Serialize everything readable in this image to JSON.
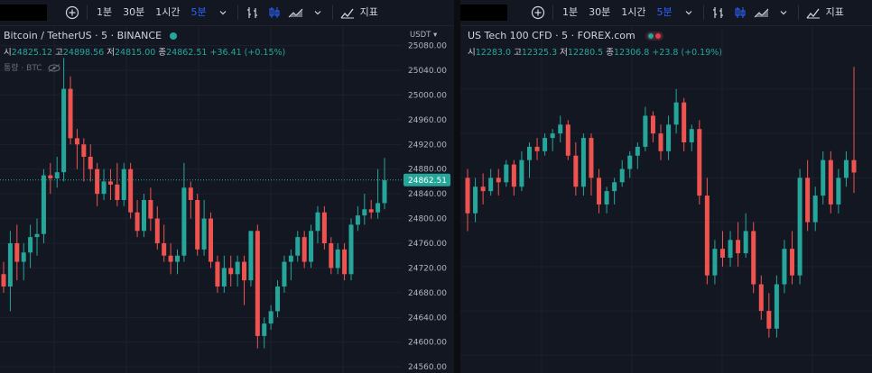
{
  "toolbar": {
    "intervals": [
      "1분",
      "30분",
      "1시간",
      "5분"
    ],
    "indicators_label": "지표"
  },
  "left": {
    "symbol_title": "Bitcoin / TetherUS · 5 · BINANCE",
    "status_color": "#26a69a",
    "ohlc": {
      "o_label": "시",
      "o": "24825.12",
      "h_label": "고",
      "h": "24898.56",
      "l_label": "저",
      "l": "24815.00",
      "c_label": "종",
      "c": "24862.51",
      "change": "+36.41 (+0.15%)"
    },
    "volume_label": "통량 · BTC",
    "currency_label": "USDT",
    "last_price": "24862.51"
  },
  "right": {
    "symbol_title": "US Tech 100 CFD · 5 · FOREX.com",
    "status_color": "#26a69a",
    "ohlc": {
      "o_label": "시",
      "o": "12283.0",
      "h_label": "고",
      "h": "12325.3",
      "l_label": "저",
      "l": "12280.5",
      "c_label": "종",
      "c": "12306.8",
      "change": "+23.8 (+0.19%)"
    }
  },
  "chart_data": [
    {
      "type": "candlestick",
      "title": "Bitcoin / TetherUS · 5 · BINANCE",
      "ylim": [
        24550,
        25110
      ],
      "yticks": [
        25080,
        25040,
        25000,
        24960,
        24920,
        24880,
        24840,
        24800,
        24760,
        24720,
        24680,
        24640,
        24600,
        24560
      ],
      "last_price": 24862.51,
      "candles": [
        [
          24710,
          24730,
          24680,
          24690
        ],
        [
          24690,
          24780,
          24650,
          24760
        ],
        [
          24760,
          24790,
          24700,
          24730
        ],
        [
          24730,
          24760,
          24700,
          24745
        ],
        [
          24745,
          24790,
          24720,
          24770
        ],
        [
          24770,
          24800,
          24740,
          24775
        ],
        [
          24775,
          24880,
          24760,
          24870
        ],
        [
          24870,
          24890,
          24840,
          24865
        ],
        [
          24865,
          24900,
          24850,
          24875
        ],
        [
          24875,
          25060,
          24860,
          25010
        ],
        [
          25010,
          25030,
          24920,
          24930
        ],
        [
          24930,
          24945,
          24880,
          24920
        ],
        [
          24920,
          24930,
          24860,
          24900
        ],
        [
          24900,
          24920,
          24860,
          24880
        ],
        [
          24880,
          24890,
          24820,
          24840
        ],
        [
          24840,
          24880,
          24830,
          24860
        ],
        [
          24860,
          24880,
          24830,
          24855
        ],
        [
          24855,
          24890,
          24820,
          24830
        ],
        [
          24830,
          24890,
          24820,
          24880
        ],
        [
          24880,
          24890,
          24800,
          24810
        ],
        [
          24810,
          24830,
          24770,
          24780
        ],
        [
          24780,
          24840,
          24770,
          24830
        ],
        [
          24830,
          24850,
          24780,
          24800
        ],
        [
          24800,
          24820,
          24750,
          24760
        ],
        [
          24760,
          24790,
          24730,
          24740
        ],
        [
          24740,
          24760,
          24710,
          24730
        ],
        [
          24730,
          24750,
          24710,
          24740
        ],
        [
          24740,
          24890,
          24730,
          24850
        ],
        [
          24850,
          24860,
          24800,
          24830
        ],
        [
          24830,
          24840,
          24740,
          24750
        ],
        [
          24750,
          24830,
          24740,
          24800
        ],
        [
          24800,
          24810,
          24720,
          24730
        ],
        [
          24730,
          24740,
          24680,
          24690
        ],
        [
          24690,
          24740,
          24680,
          24720
        ],
        [
          24720,
          24740,
          24690,
          24710
        ],
        [
          24710,
          24740,
          24690,
          24730
        ],
        [
          24730,
          24740,
          24660,
          24700
        ],
        [
          24700,
          24760,
          24690,
          24780
        ],
        [
          24780,
          24790,
          24590,
          24610
        ],
        [
          24610,
          24640,
          24590,
          24630
        ],
        [
          24630,
          24660,
          24620,
          24650
        ],
        [
          24650,
          24700,
          24640,
          24690
        ],
        [
          24690,
          24740,
          24680,
          24730
        ],
        [
          24730,
          24750,
          24700,
          24740
        ],
        [
          24740,
          24780,
          24730,
          24770
        ],
        [
          24770,
          24780,
          24720,
          24730
        ],
        [
          24730,
          24790,
          24720,
          24780
        ],
        [
          24780,
          24820,
          24760,
          24810
        ],
        [
          24810,
          24820,
          24750,
          24760
        ],
        [
          24760,
          24770,
          24710,
          24720
        ],
        [
          24720,
          24760,
          24710,
          24750
        ],
        [
          24750,
          24760,
          24700,
          24710
        ],
        [
          24710,
          24800,
          24700,
          24790
        ],
        [
          24790,
          24820,
          24780,
          24805
        ],
        [
          24805,
          24840,
          24790,
          24815
        ],
        [
          24815,
          24830,
          24800,
          24810
        ],
        [
          24810,
          24880,
          24800,
          24825
        ],
        [
          24825,
          24898,
          24815,
          24862
        ]
      ]
    },
    {
      "type": "candlestick",
      "title": "US Tech 100 CFD · 5 · FOREX.com",
      "candles": [
        [
          12300,
          12310,
          12240,
          12260
        ],
        [
          12260,
          12300,
          12250,
          12290
        ],
        [
          12290,
          12305,
          12270,
          12285
        ],
        [
          12285,
          12310,
          12280,
          12300
        ],
        [
          12300,
          12310,
          12280,
          12295
        ],
        [
          12295,
          12320,
          12290,
          12315
        ],
        [
          12315,
          12320,
          12280,
          12290
        ],
        [
          12290,
          12330,
          12285,
          12320
        ],
        [
          12320,
          12340,
          12300,
          12335
        ],
        [
          12335,
          12345,
          12320,
          12330
        ],
        [
          12330,
          12350,
          12325,
          12345
        ],
        [
          12345,
          12355,
          12330,
          12350
        ],
        [
          12350,
          12370,
          12340,
          12360
        ],
        [
          12360,
          12365,
          12320,
          12325
        ],
        [
          12325,
          12340,
          12280,
          12290
        ],
        [
          12290,
          12350,
          12280,
          12345
        ],
        [
          12345,
          12350,
          12280,
          12300
        ],
        [
          12300,
          12310,
          12260,
          12270
        ],
        [
          12270,
          12290,
          12260,
          12285
        ],
        [
          12285,
          12300,
          12270,
          12295
        ],
        [
          12295,
          12320,
          12290,
          12310
        ],
        [
          12310,
          12330,
          12300,
          12325
        ],
        [
          12325,
          12340,
          12310,
          12335
        ],
        [
          12335,
          12380,
          12330,
          12370
        ],
        [
          12370,
          12375,
          12340,
          12350
        ],
        [
          12350,
          12360,
          12320,
          12330
        ],
        [
          12330,
          12370,
          12320,
          12360
        ],
        [
          12360,
          12400,
          12350,
          12385
        ],
        [
          12385,
          12390,
          12330,
          12340
        ],
        [
          12340,
          12360,
          12330,
          12355
        ],
        [
          12355,
          12365,
          12270,
          12280
        ],
        [
          12280,
          12300,
          12180,
          12190
        ],
        [
          12190,
          12230,
          12180,
          12220
        ],
        [
          12220,
          12240,
          12200,
          12210
        ],
        [
          12210,
          12240,
          12200,
          12230
        ],
        [
          12230,
          12250,
          12200,
          12215
        ],
        [
          12215,
          12260,
          12210,
          12240
        ],
        [
          12240,
          12250,
          12170,
          12180
        ],
        [
          12180,
          12190,
          12140,
          12150
        ],
        [
          12150,
          12170,
          12120,
          12130
        ],
        [
          12130,
          12190,
          12120,
          12180
        ],
        [
          12180,
          12230,
          12170,
          12220
        ],
        [
          12220,
          12240,
          12180,
          12190
        ],
        [
          12190,
          12310,
          12180,
          12300
        ],
        [
          12300,
          12320,
          12240,
          12250
        ],
        [
          12250,
          12290,
          12240,
          12280
        ],
        [
          12280,
          12330,
          12270,
          12320
        ],
        [
          12320,
          12330,
          12260,
          12270
        ],
        [
          12270,
          12310,
          12260,
          12300
        ],
        [
          12300,
          12330,
          12290,
          12320
        ],
        [
          12320,
          12425,
          12283,
          12306
        ]
      ]
    }
  ]
}
